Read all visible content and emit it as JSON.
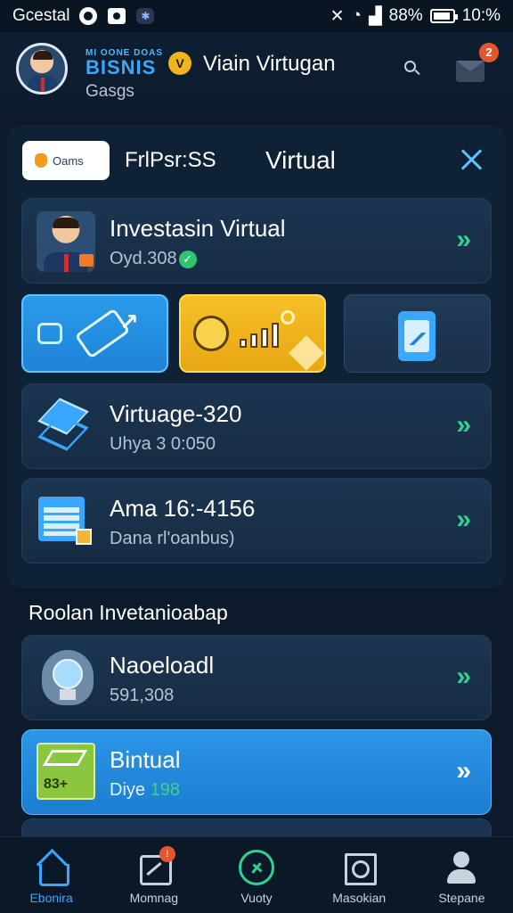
{
  "status_bar": {
    "carrier": "Gcestal",
    "battery_text": "88%",
    "time": "10:%",
    "battery_level": 0.88
  },
  "header": {
    "brand_small": "MI OONE DOAS",
    "brand_big": "BISNIS",
    "title": "Viain Virtugan",
    "subtitle": "Gasgs",
    "mail_badge": "2"
  },
  "panel": {
    "pill_label": "Oams",
    "label": "FrlPsr:SS",
    "title": "Virtual"
  },
  "cards": [
    {
      "title": "Investasin Virtual",
      "sub": "Oyd.308",
      "chevron": "»"
    },
    {
      "title": "Virtuage-320",
      "sub": "Uhya 3 0:050",
      "chevron": "»"
    },
    {
      "title": "Ama 16:-4156",
      "sub": "Dana rl'oanbus)",
      "chevron": "»"
    }
  ],
  "section": {
    "title": "Roolan Invetanioabap"
  },
  "section_cards": [
    {
      "title": "Naoeloadl",
      "sub": "591,308",
      "chevron": "»"
    },
    {
      "title": "Bintual",
      "sub_prefix": "Diye",
      "sub_value": "198",
      "icon_text": "83+",
      "chevron": "»"
    }
  ],
  "bottom_nav": [
    {
      "label": "Ebonira",
      "icon": "home-icon",
      "active": true
    },
    {
      "label": "Momnag",
      "icon": "message-icon",
      "badge": "!"
    },
    {
      "label": "Vuoty",
      "icon": "compass-icon"
    },
    {
      "label": "Masokian",
      "icon": "frame-icon"
    },
    {
      "label": "Stepane",
      "icon": "user-icon"
    }
  ],
  "colors": {
    "background": "#0c1a2b",
    "accent_blue": "#3aa7ff",
    "accent_green": "#2fd28e",
    "accent_gold": "#f2c23a",
    "badge_red": "#e4572e"
  }
}
